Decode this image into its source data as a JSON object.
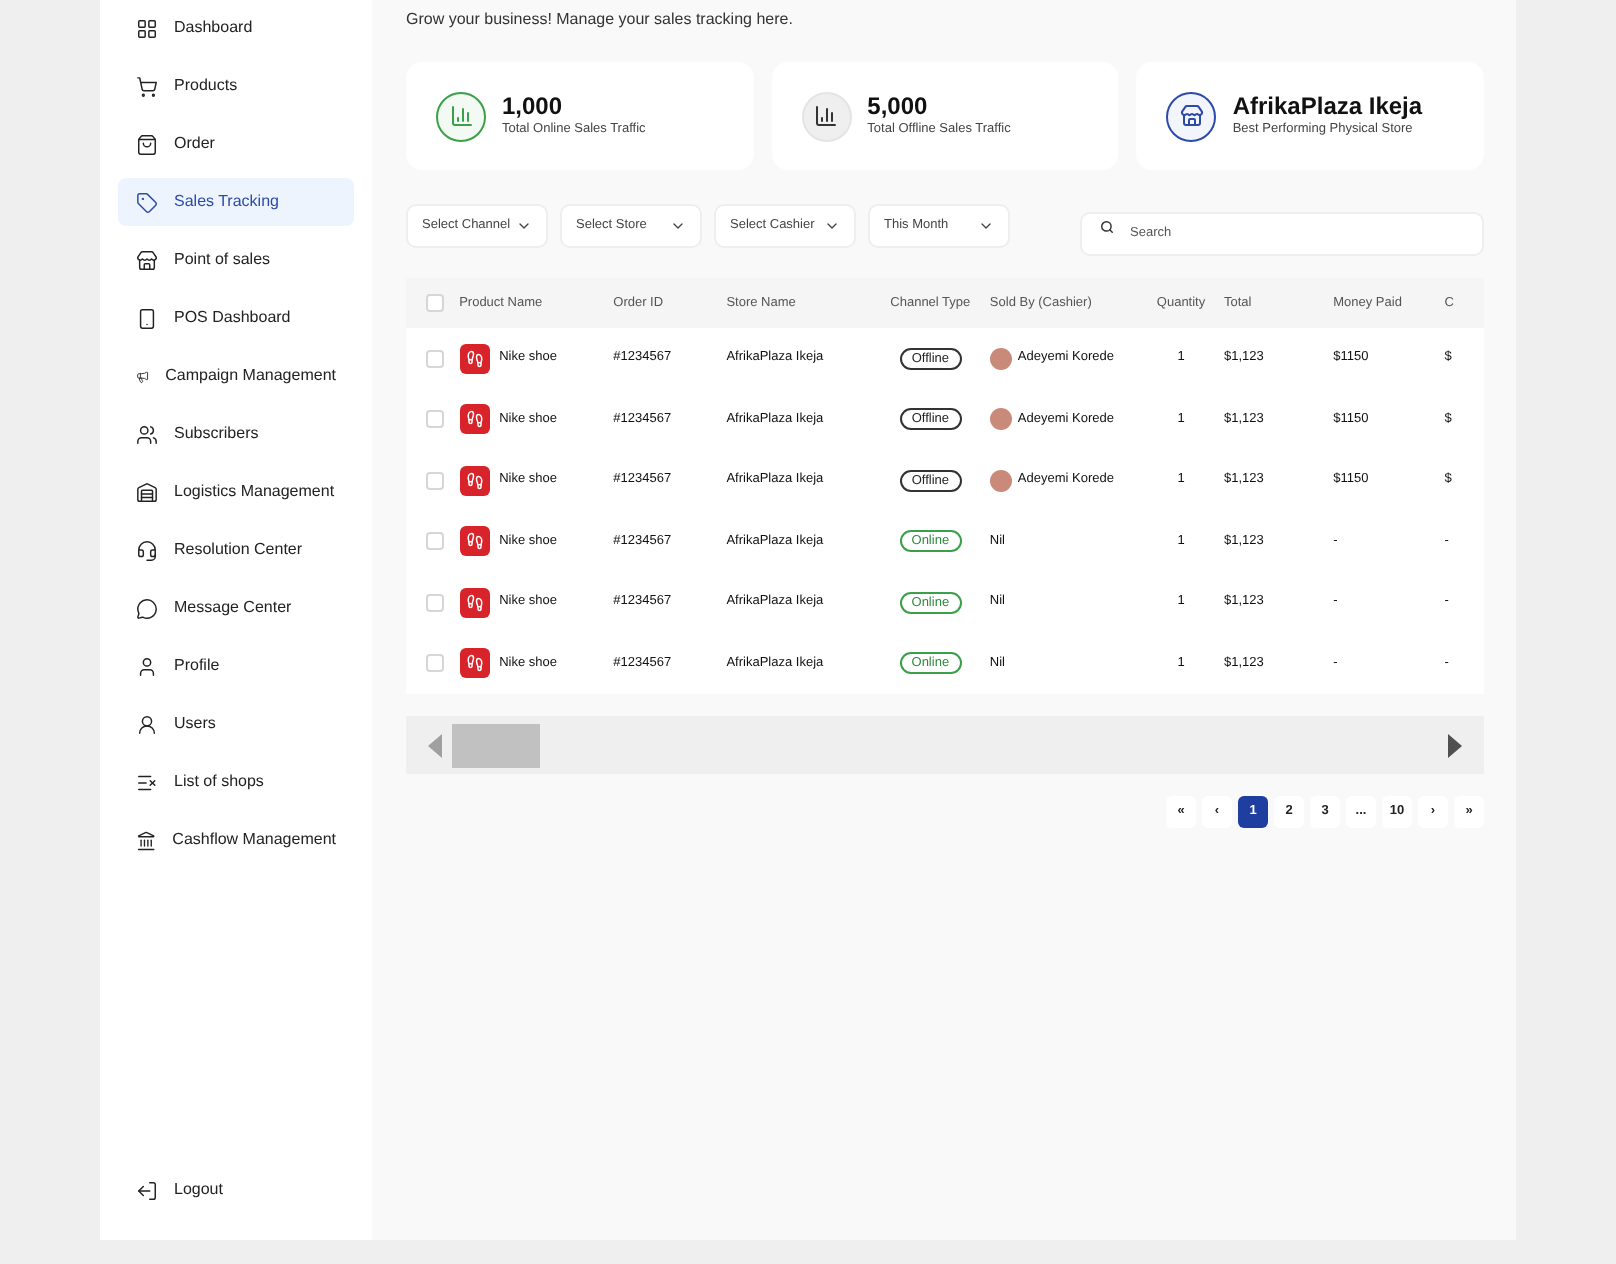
{
  "sidebar": {
    "items": [
      {
        "label": "Dashboard",
        "selected": false
      },
      {
        "label": "Products",
        "selected": false
      },
      {
        "label": "Order",
        "selected": false
      },
      {
        "label": "Sales Tracking",
        "selected": true
      },
      {
        "label": "Point of sales",
        "selected": false
      },
      {
        "label": "POS Dashboard",
        "selected": false
      },
      {
        "label": "Campaign Management",
        "selected": false
      },
      {
        "label": "Subscribers",
        "selected": false
      },
      {
        "label": "Logistics Management",
        "selected": false
      },
      {
        "label": "Resolution Center",
        "selected": false
      },
      {
        "label": "Message Center",
        "selected": false
      },
      {
        "label": "Profile",
        "selected": false
      },
      {
        "label": "Users",
        "selected": false
      },
      {
        "label": "List of shops",
        "selected": false
      },
      {
        "label": "Cashflow Management",
        "selected": false
      }
    ],
    "logout": "Logout"
  },
  "subtitle": "Grow your business! Manage your sales tracking here.",
  "stats": [
    {
      "kind": "online",
      "value": "1,000",
      "label": "Total Online Sales Traffic"
    },
    {
      "kind": "offline",
      "value": "5,000",
      "label": "Total Offline Sales Traffic"
    },
    {
      "kind": "store",
      "value": "AfrikaPlaza Ikeja",
      "label": "Best Performing Physical Store"
    }
  ],
  "filters": [
    "Select Channel",
    "Select Store",
    "Select Cashier",
    "This Month"
  ],
  "search": {
    "placeholder": "Search"
  },
  "table": {
    "header_checked": false,
    "columns": [
      "Product Name",
      "Order ID",
      "Store Name",
      "Channel Type",
      "Sold By (Cashier)",
      "Quantity",
      "Total",
      "Money Paid",
      "C"
    ],
    "rows": [
      {
        "checked": false,
        "product": "Nike shoe",
        "order_id": "#1234567",
        "store": "AfrikaPlaza Ikeja",
        "channel": {
          "kind": "offline",
          "label": "Offline"
        },
        "sold_by": {
          "name": "Adeyemi Korede",
          "avatar": true
        },
        "quantity": "1",
        "total": "$1,123",
        "money_paid": "$1150",
        "column_9": "$"
      },
      {
        "checked": false,
        "product": "Nike shoe",
        "order_id": "#1234567",
        "store": "AfrikaPlaza Ikeja",
        "channel": {
          "kind": "offline",
          "label": "Offline"
        },
        "sold_by": {
          "name": "Adeyemi Korede",
          "avatar": true
        },
        "quantity": "1",
        "total": "$1,123",
        "money_paid": "$1150",
        "column_9": "$"
      },
      {
        "checked": false,
        "product": "Nike shoe",
        "order_id": "#1234567",
        "store": "AfrikaPlaza Ikeja",
        "channel": {
          "kind": "offline",
          "label": "Offline"
        },
        "sold_by": {
          "name": "Adeyemi Korede",
          "avatar": true
        },
        "quantity": "1",
        "total": "$1,123",
        "money_paid": "$1150",
        "column_9": "$"
      },
      {
        "checked": false,
        "product": "Nike shoe",
        "order_id": "#1234567",
        "store": "AfrikaPlaza Ikeja",
        "channel": {
          "kind": "online",
          "label": "Online"
        },
        "sold_by": {
          "name": "Nil",
          "avatar": false
        },
        "quantity": "1",
        "total": "$1,123",
        "money_paid": "-",
        "column_9": "-"
      },
      {
        "checked": false,
        "product": "Nike shoe",
        "order_id": "#1234567",
        "store": "AfrikaPlaza Ikeja",
        "channel": {
          "kind": "online",
          "label": "Online"
        },
        "sold_by": {
          "name": "Nil",
          "avatar": false
        },
        "quantity": "1",
        "total": "$1,123",
        "money_paid": "-",
        "column_9": "-"
      },
      {
        "checked": false,
        "product": "Nike shoe",
        "order_id": "#1234567",
        "store": "AfrikaPlaza Ikeja",
        "channel": {
          "kind": "online",
          "label": "Online"
        },
        "sold_by": {
          "name": "Nil",
          "avatar": false
        },
        "quantity": "1",
        "total": "$1,123",
        "money_paid": "-",
        "column_9": "-"
      }
    ]
  },
  "pagination": [
    {
      "label": "«",
      "selected": false
    },
    {
      "label": "‹",
      "selected": false
    },
    {
      "label": "1",
      "selected": true
    },
    {
      "label": "2",
      "selected": false
    },
    {
      "label": "3",
      "selected": false
    },
    {
      "label": "...",
      "selected": false
    },
    {
      "label": "10",
      "selected": false
    },
    {
      "label": "›",
      "selected": false
    },
    {
      "label": "»",
      "selected": false
    }
  ]
}
